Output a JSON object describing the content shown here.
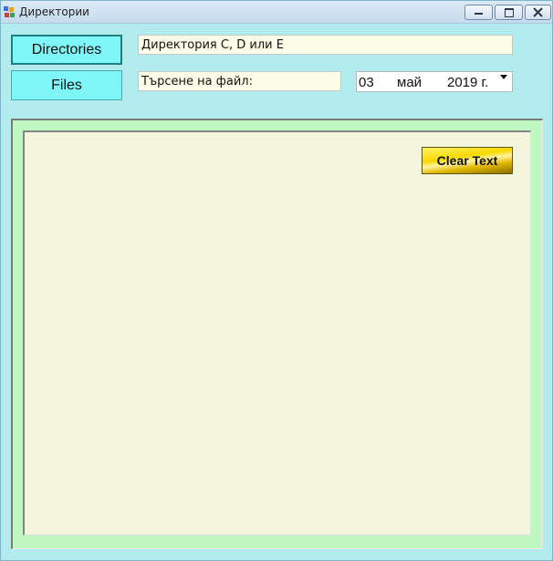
{
  "window": {
    "title": "Директории",
    "icon": "app-icon",
    "controls": {
      "minimize_icon": "minimize-icon",
      "maximize_icon": "maximize-icon",
      "close_icon": "close-icon"
    }
  },
  "buttons": {
    "directories_label": "Directories",
    "files_label": "Files",
    "clear_text_label": "Clear Text"
  },
  "inputs": {
    "directory_value": "Директория C, D или E",
    "search_value": "Търсене на файл:"
  },
  "date_picker": {
    "day": "03",
    "month": "май",
    "year": "2019 г."
  },
  "colors": {
    "background": "#b2ecee",
    "button_cyan": "#7ff6f8",
    "panel_green": "#c1f7c1",
    "text_area": "#f5f5de",
    "clear_button_yellow": "#f7d800"
  }
}
